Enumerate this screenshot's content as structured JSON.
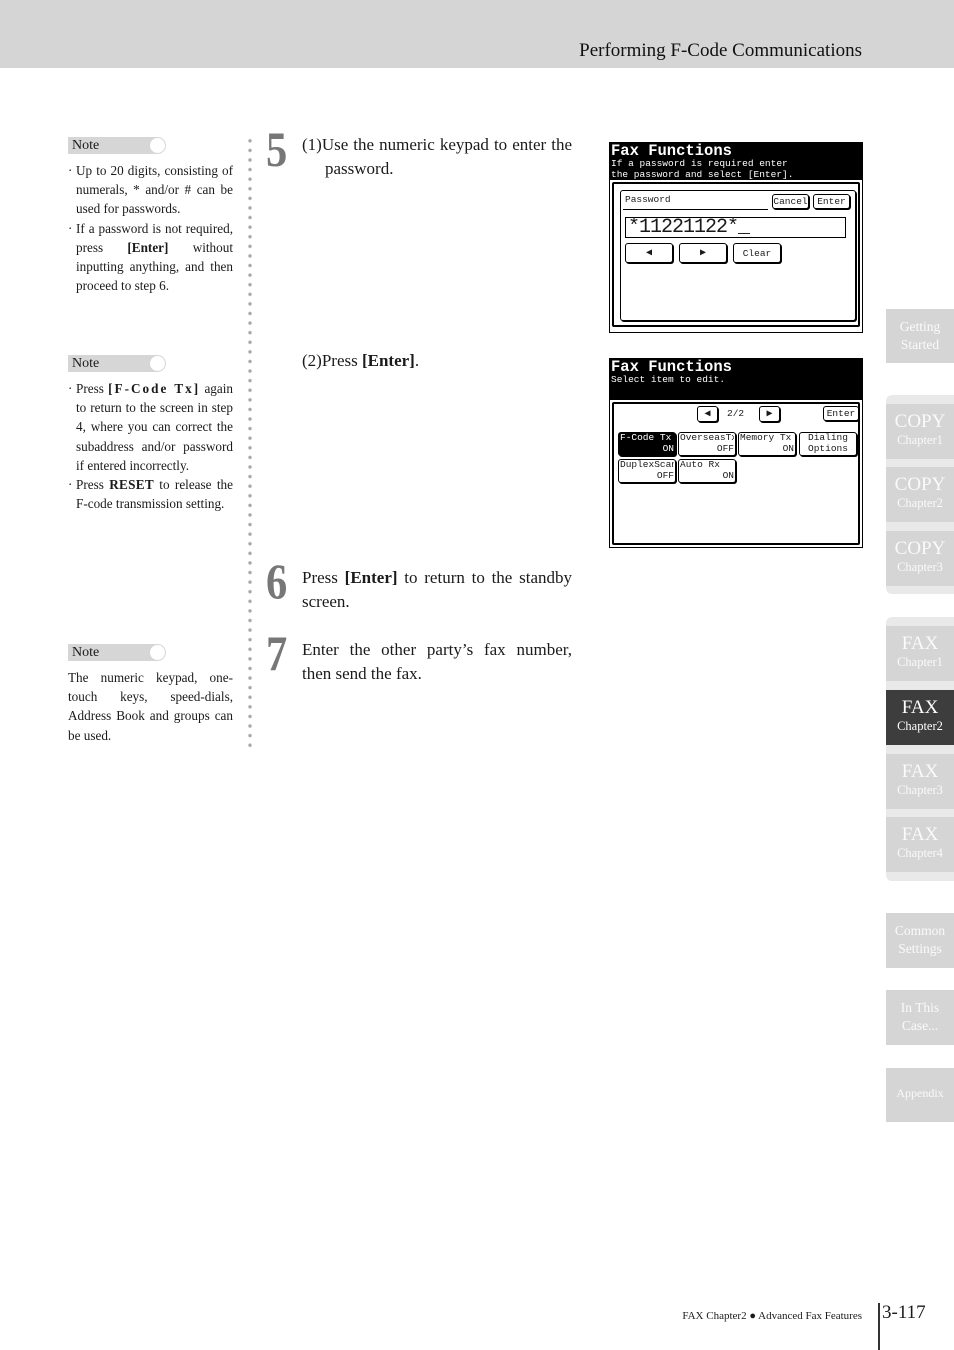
{
  "header": {
    "title": "Performing F-Code Communications"
  },
  "notes": [
    {
      "label": "Note",
      "items": [
        "Up to 20 digits, consisting of numerals, * and/or # can be used for passwords.",
        {
          "pre": "If a password is not required, press ",
          "bold": "[Enter]",
          "post": " without inputting anything, and then proceed to step 6."
        }
      ]
    },
    {
      "label": "Note",
      "items": [
        {
          "pre": "Press ",
          "bold": "[F-Code Tx]",
          "post": " again to return to the screen in step 4, where you can correct the subaddress and/or password if entered incorrectly."
        },
        {
          "pre": "Press ",
          "key": "RESET",
          "post": " to release the F-code transmission setting."
        }
      ]
    },
    {
      "label": "Note",
      "text": "The numeric keypad, one-touch keys, speed-dials, Address Book and groups can be used."
    }
  ],
  "steps": [
    {
      "number": "5",
      "sub1": "(1)Use the numeric keypad to enter the password.",
      "sub2_pre": "(2)Press ",
      "sub2_bold": "[Enter]",
      "sub2_post": "."
    },
    {
      "number": "6",
      "pre": "Press ",
      "bold": "[Enter]",
      "post": " to return to the standby screen."
    },
    {
      "number": "7",
      "text": "Enter the other party’s fax number, then send the fax."
    }
  ],
  "screen1": {
    "title": "Fax Functions",
    "subtitle_line1": "If a password is required enter",
    "subtitle_line2": "the password and select [Enter].",
    "field_label": "Password",
    "cancel": "Cancel",
    "enter": "Enter",
    "value": "*11221122*_",
    "left_arrow": "◀",
    "right_arrow": "▶",
    "clear": "Clear"
  },
  "screen2": {
    "title": "Fax Functions",
    "subtitle": "Select item to edit.",
    "page": "2/2",
    "left_arrow": "◀",
    "right_arrow": "▶",
    "enter": "Enter",
    "buttons": [
      {
        "name": "F-Code Tx",
        "value": "ON",
        "active": true
      },
      {
        "name": "OverseasTx",
        "value": "OFF"
      },
      {
        "name": "Memory Tx",
        "value": "ON"
      },
      {
        "name": "Dialing",
        "value": "Options"
      },
      {
        "name": "DuplexScan",
        "value": "OFF"
      },
      {
        "name": "Auto Rx",
        "value": "ON"
      }
    ]
  },
  "tabs": {
    "getting_started": [
      "Getting",
      "Started"
    ],
    "copy": [
      {
        "big": "COPY",
        "small": "Chapter1"
      },
      {
        "big": "COPY",
        "small": "Chapter2"
      },
      {
        "big": "COPY",
        "small": "Chapter3"
      }
    ],
    "fax": [
      {
        "big": "FAX",
        "small": "Chapter1"
      },
      {
        "big": "FAX",
        "small": "Chapter2",
        "active": true
      },
      {
        "big": "FAX",
        "small": "Chapter3"
      },
      {
        "big": "FAX",
        "small": "Chapter4"
      }
    ],
    "common_settings": [
      "Common",
      "Settings"
    ],
    "in_this_case": [
      "In This",
      "Case..."
    ],
    "appendix": "Appendix"
  },
  "footer": {
    "chapter": "FAX Chapter2",
    "bullet": "●",
    "section": "Advanced Fax Features",
    "page": "3-117"
  }
}
